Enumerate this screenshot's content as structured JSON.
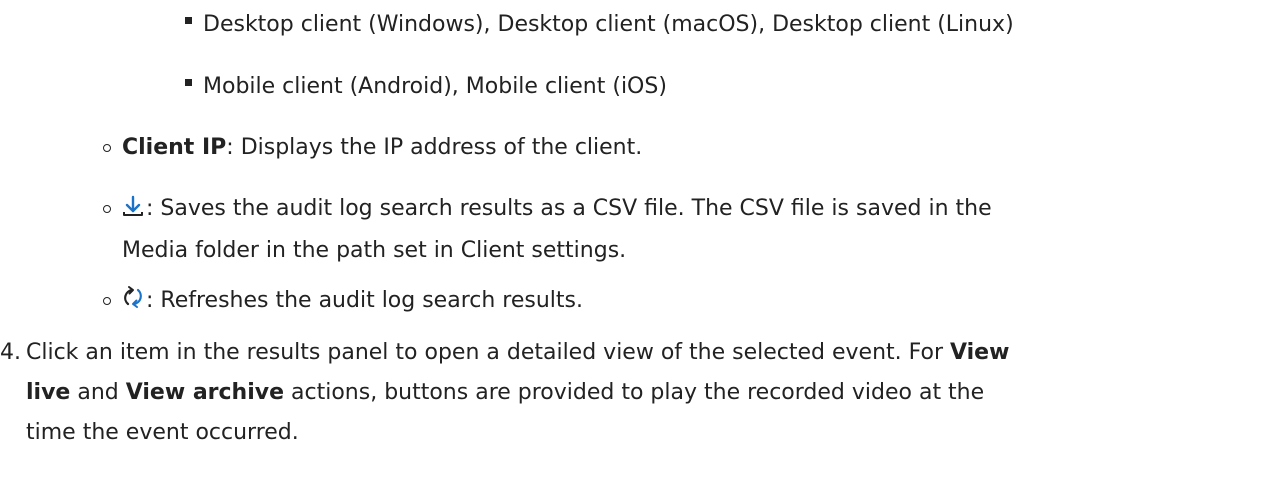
{
  "list": {
    "sub_bullets": [
      "Desktop client (Windows), Desktop client (macOS), Desktop client (Linux)",
      "Mobile client (Android), Mobile client (iOS)"
    ],
    "client_ip": {
      "term": "Client IP",
      "desc": ": Displays the IP address of the client."
    },
    "download": {
      "icon": "download-icon",
      "desc_line1": ": Saves the audit log search results as a CSV file. The CSV file is saved in the",
      "desc_line2": "Media folder in the path set in Client settings."
    },
    "refresh": {
      "icon": "refresh-icon",
      "desc": ": Refreshes the audit log search results."
    },
    "step4": {
      "number": "4.",
      "text_a": "Click an item in the results panel to open a detailed view of the selected event. For ",
      "bold_view_live": "View",
      "bold_view_live_2": "live",
      "text_b": " and ",
      "bold_view_archive": "View archive",
      "text_c": " actions, buttons are provided to play the recorded video at the",
      "text_d": "time the event occurred."
    }
  }
}
